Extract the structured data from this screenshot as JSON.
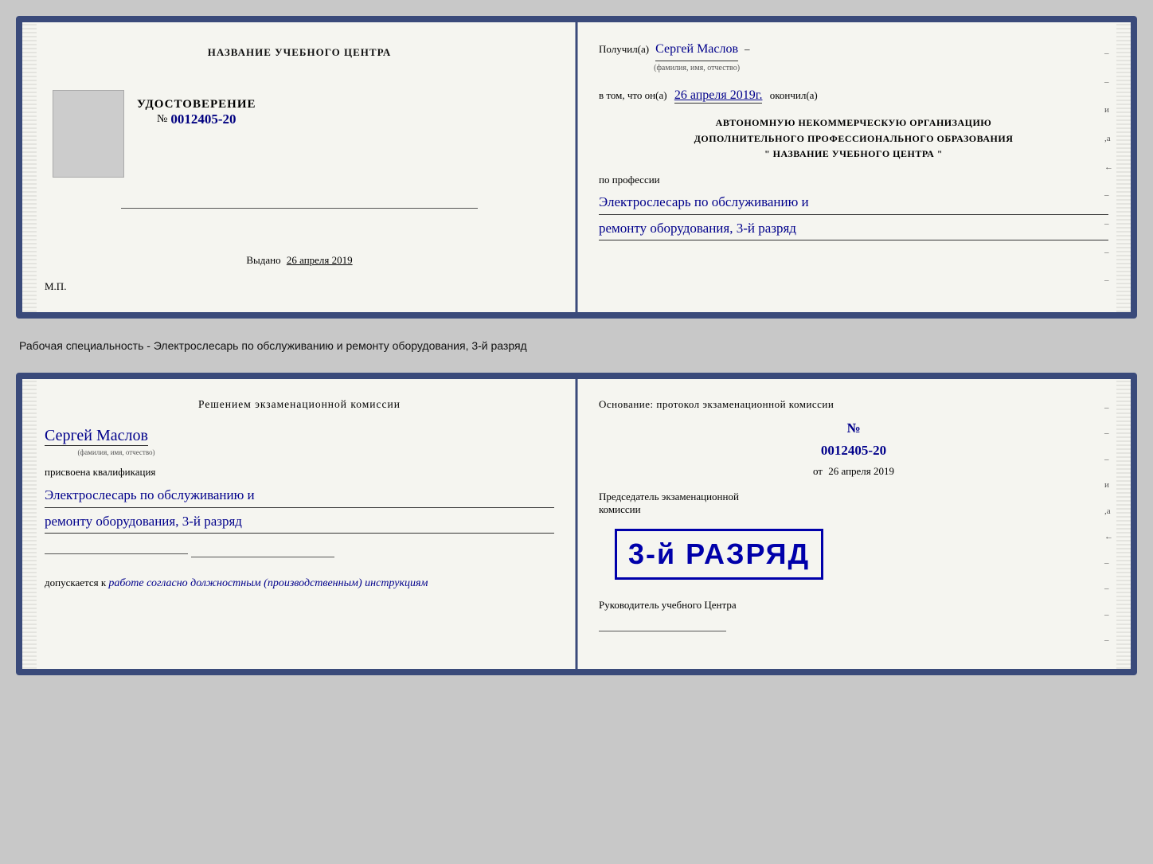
{
  "top_doc": {
    "left": {
      "training_center_label": "НАЗВАНИЕ УЧЕБНОГО ЦЕНТРА",
      "udost_label": "УДОСТОВЕРЕНИЕ",
      "udost_num_prefix": "№",
      "udost_num": "0012405-20",
      "vydano_label": "Выдано",
      "vydano_date": "26 апреля 2019",
      "mp": "М.П."
    },
    "right": {
      "poluchil_label": "Получил(а)",
      "name": "Сергей Маслов",
      "name_sub": "(фамилия, имя, отчество)",
      "dash": "–",
      "vtom_label": "в том, что он(а)",
      "date_handwritten": "26 апреля 2019г.",
      "okonchill": "окончил(а)",
      "autonomy_line1": "АВТОНОМНУЮ НЕКОММЕРЧЕСКУЮ ОРГАНИЗАЦИЮ",
      "autonomy_line2": "ДОПОЛНИТЕЛЬНОГО ПРОФЕССИОНАЛЬНОГО ОБРАЗОВАНИЯ",
      "autonomy_center": "\"   НАЗВАНИЕ УЧЕБНОГО ЦЕНТРА   \"",
      "po_professii": "по профессии",
      "profession1": "Электрослесарь по обслуживанию и",
      "profession2": "ремонту оборудования, 3-й разряд"
    }
  },
  "description": "Рабочая специальность - Электрослесарь по обслуживанию и ремонту оборудования, 3-й разряд",
  "bottom_doc": {
    "left": {
      "resheniye": "Решением экзаменационной комиссии",
      "name": "Сергей Маслов",
      "name_sub": "(фамилия, имя, отчество)",
      "prisvoena": "присвоена квалификация",
      "qual1": "Электрослесарь по обслуживанию и",
      "qual2": "ремонту оборудования, 3-й разряд",
      "dopuskaetsya": "допускается к",
      "dopusk_text": "работе согласно должностным (производственным) инструкциям"
    },
    "right": {
      "osnovaniye": "Основание: протокол экзаменационной комиссии",
      "num_prefix": "№",
      "num": "0012405-20",
      "ot_label": "от",
      "ot_date": "26 апреля 2019",
      "chairman_label": "Председатель экзаменационной комиссии",
      "stamp_text": "3-й РАЗРЯД",
      "rukavod_label": "Руководитель учебного Центра"
    }
  }
}
